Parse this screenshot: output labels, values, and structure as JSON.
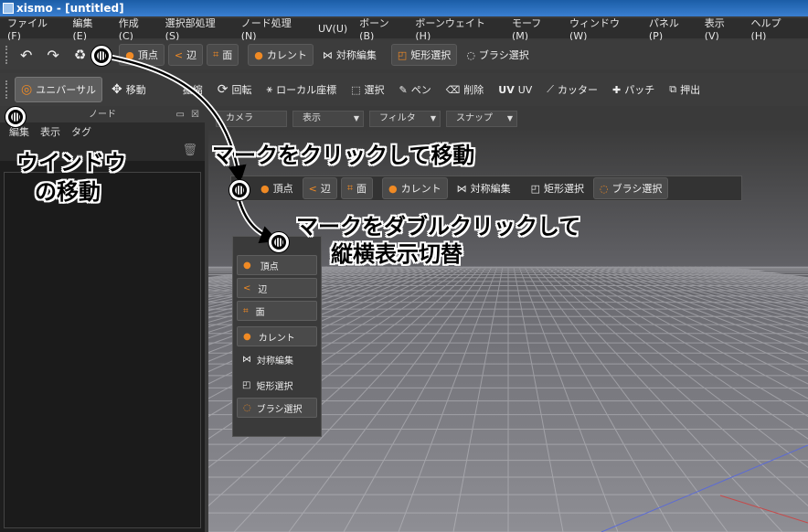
{
  "window": {
    "title": "xismo - [untitled]"
  },
  "menu": [
    "ファイル(F)",
    "編集(E)",
    "作成(C)",
    "選択部処理(S)",
    "ノード処理(N)",
    "UV(U)",
    "ボーン(B)",
    "ボーンウェイト(H)",
    "モーフ(M)",
    "ウィンドウ(W)",
    "パネル(P)",
    "表示(V)",
    "ヘルプ(H)"
  ],
  "toolbar1": {
    "vertex": "頂点",
    "edge": "辺",
    "face": "面",
    "current": "カレント",
    "symmetry": "対称編集",
    "rect_select": "矩形選択",
    "brush_select": "ブラシ選択"
  },
  "toolbar2": {
    "universal": "ユニバーサル",
    "move": "移動",
    "scale": "拡縮",
    "rotate": "回転",
    "local_coord": "ローカル座標",
    "select": "選択",
    "pen": "ペン",
    "delete": "削除",
    "uv": "UV",
    "cutter": "カッター",
    "patch": "パッチ",
    "extrude": "押出"
  },
  "node_panel": {
    "title": "ノード",
    "menu": [
      "編集",
      "表示",
      "タグ"
    ]
  },
  "viewbar": {
    "camera": "カメラ",
    "display": "表示",
    "filter": "フィルタ",
    "snap": "スナップ"
  },
  "floating_h": {
    "vertex": "頂点",
    "edge": "辺",
    "face": "面",
    "current": "カレント",
    "symmetry": "対称編集",
    "rect_select": "矩形選択",
    "brush_select": "ブラシ選択"
  },
  "floating_v": {
    "vertex": "頂点",
    "edge": "辺",
    "face": "面",
    "current": "カレント",
    "symmetry": "対称編集",
    "rect_select": "矩形選択",
    "brush_select": "ブラシ選択"
  },
  "annotations": {
    "window_move_1": "ウインドウ",
    "window_move_2": "の移動",
    "click_move": "マークをクリックして移動",
    "dbl_click_1": "マークをダブルクリックして",
    "dbl_click_2": "縦横表示切替"
  },
  "colors": {
    "accent": "#f08a24",
    "titlebar": "#2a6fc0",
    "panel_bg": "#1e1e1e"
  }
}
